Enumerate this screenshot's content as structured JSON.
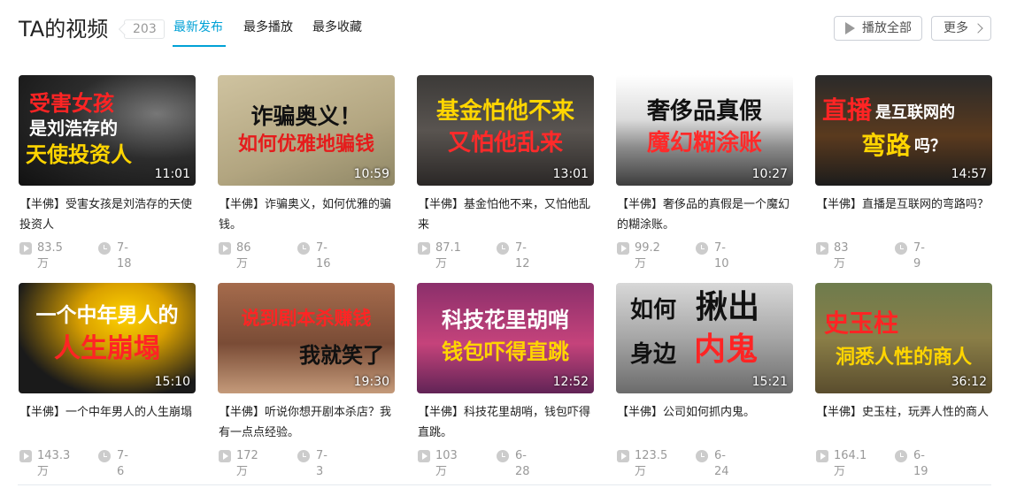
{
  "header": {
    "title": "TA的视频",
    "count": "203",
    "tabs": [
      "最新发布",
      "最多播放",
      "最多收藏"
    ],
    "active_tab": 0,
    "play_all": "播放全部",
    "more": "更多"
  },
  "colors": {
    "accent": "#00a1d6",
    "meta": "#999999"
  },
  "videos": [
    {
      "cap1": "受害女孩",
      "cap2": "是刘浩存的",
      "cap3": "天使投资人",
      "duration": "11:01",
      "title": "【半佛】受害女孩是刘浩存的天使投资人",
      "plays": "83.5万",
      "date": "7-18"
    },
    {
      "cap1": "诈骗奥义！",
      "cap2": "如何优雅地骗钱",
      "duration": "10:59",
      "title": "【半佛】诈骗奥义，如何优雅的骗钱。",
      "plays": "86万",
      "date": "7-16"
    },
    {
      "cap1": "基金怕他不来",
      "cap2": "又怕他乱来",
      "duration": "13:01",
      "title": "【半佛】基金怕他不来，又怕他乱来",
      "plays": "87.1万",
      "date": "7-12"
    },
    {
      "cap1": "奢侈品真假",
      "cap2": "魔幻糊涂账",
      "duration": "10:27",
      "title": "【半佛】奢侈品的真假是一个魔幻的糊涂账。",
      "plays": "99.2万",
      "date": "7-10"
    },
    {
      "cap1": "直播",
      "cap1b": "是互联网的",
      "cap2": "弯路",
      "cap2b": "吗？",
      "duration": "14:57",
      "title": "【半佛】直播是互联网的弯路吗？",
      "plays": "83万",
      "date": "7-9"
    },
    {
      "cap1": "一个中年男人的",
      "cap2": "人生崩塌",
      "duration": "15:10",
      "title": "【半佛】一个中年男人的人生崩塌",
      "plays": "143.3万",
      "date": "7-6"
    },
    {
      "cap1": "说到剧本杀赚钱",
      "cap2": "我就笑了",
      "duration": "19:30",
      "title": "【半佛】听说你想开剧本杀店？我有一点点经验。",
      "plays": "172万",
      "date": "7-3"
    },
    {
      "cap1": "科技花里胡哨",
      "cap2": "钱包吓得直跳",
      "duration": "12:52",
      "title": "【半佛】科技花里胡哨，钱包吓得直跳。",
      "plays": "103万",
      "date": "6-28"
    },
    {
      "cap1": "如何",
      "cap1b": "揪出",
      "cap2": "身边",
      "cap2b": "内鬼",
      "duration": "15:21",
      "title": "【半佛】公司如何抓内鬼。",
      "plays": "123.5万",
      "date": "6-24"
    },
    {
      "cap1": "史玉柱",
      "cap2": "洞悉人性的商人",
      "duration": "36:12",
      "title": "【半佛】史玉柱，玩弄人性的商人",
      "plays": "164.1万",
      "date": "6-19"
    }
  ]
}
